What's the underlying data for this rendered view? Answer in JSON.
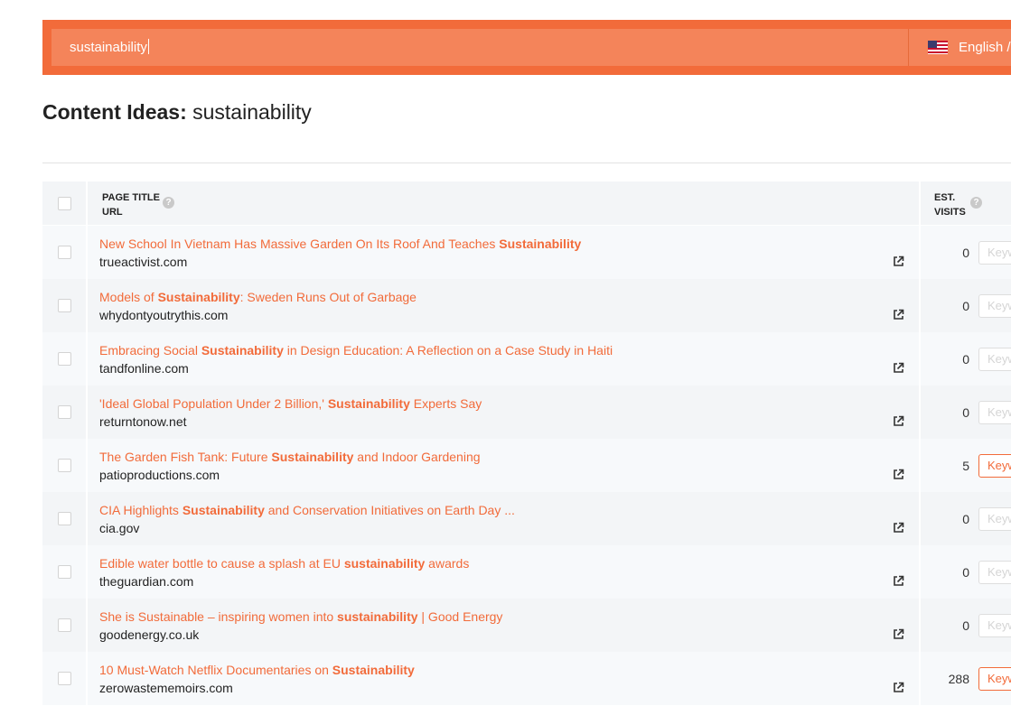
{
  "search": {
    "query": "sustainability",
    "language": "English /"
  },
  "page": {
    "title_label": "Content Ideas:",
    "title_query": "sustainability"
  },
  "table": {
    "col_title_1": "PAGE TITLE",
    "col_title_2": "URL",
    "col_visits_1": "EST.",
    "col_visits_2": "VISITS",
    "help_glyph": "?",
    "rows": [
      {
        "pre": "New School In Vietnam Has Massive Garden On Its Roof And Teaches ",
        "bold": "Sustainability",
        "post": "",
        "url": "trueactivist.com",
        "visits": "0",
        "kw": "Keyw",
        "kw_active": false
      },
      {
        "pre": "Models of ",
        "bold": "Sustainability",
        "post": ": Sweden Runs Out of Garbage",
        "url": "whydontyoutrythis.com",
        "visits": "0",
        "kw": "Keyw",
        "kw_active": false
      },
      {
        "pre": "Embracing Social ",
        "bold": "Sustainability",
        "post": " in Design Education: A Reflection on a Case Study in Haiti",
        "url": "tandfonline.com",
        "visits": "0",
        "kw": "Keyw",
        "kw_active": false
      },
      {
        "pre": "'Ideal Global Population Under 2 Billion,' ",
        "bold": "Sustainability",
        "post": " Experts Say",
        "url": "returntonow.net",
        "visits": "0",
        "kw": "Keyw",
        "kw_active": false
      },
      {
        "pre": "The Garden Fish Tank: Future ",
        "bold": "Sustainability",
        "post": " and Indoor Gardening",
        "url": "patioproductions.com",
        "visits": "5",
        "kw": "Keyw",
        "kw_active": true
      },
      {
        "pre": "CIA Highlights ",
        "bold": "Sustainability",
        "post": " and Conservation Initiatives on Earth Day ...",
        "url": "cia.gov",
        "visits": "0",
        "kw": "Keyw",
        "kw_active": false
      },
      {
        "pre": "Edible water bottle to cause a splash at EU ",
        "bold": "sustainability",
        "post": " awards",
        "url": "theguardian.com",
        "visits": "0",
        "kw": "Keyw",
        "kw_active": false
      },
      {
        "pre": "She is Sustainable – inspiring women into ",
        "bold": "sustainability",
        "post": " | Good Energy",
        "url": "goodenergy.co.uk",
        "visits": "0",
        "kw": "Keyw",
        "kw_active": false
      },
      {
        "pre": "10 Must-Watch Netflix Documentaries on ",
        "bold": "Sustainability",
        "post": "",
        "url": "zerowastememoirs.com",
        "visits": "288",
        "kw": "Keyw",
        "kw_active": true
      }
    ]
  },
  "colors": {
    "brand_orange": "#f26b3a",
    "search_field": "#f4845a",
    "row_bg_light": "#f7f9fb",
    "row_bg_dark": "#f3f5f7"
  },
  "icons": {
    "flag": "us-flag-icon",
    "help": "help-icon",
    "external": "external-link-icon"
  }
}
